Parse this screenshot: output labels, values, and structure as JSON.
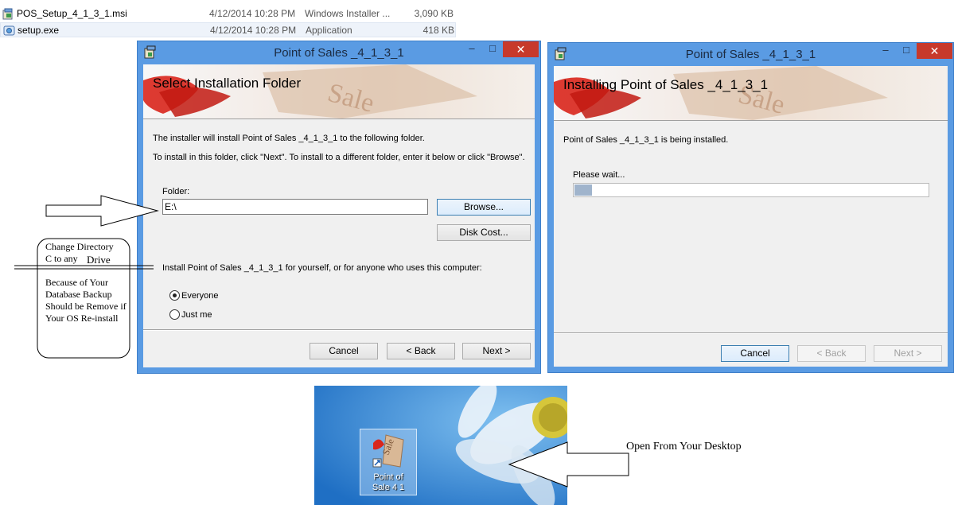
{
  "files": [
    {
      "name": "POS_Setup_4_1_3_1.msi",
      "date": "4/12/2014 10:28 PM",
      "type": "Windows Installer ...",
      "size": "3,090 KB",
      "icon": "msi-package-icon"
    },
    {
      "name": "setup.exe",
      "date": "4/12/2014 10:28 PM",
      "type": "Application",
      "size": "418 KB",
      "icon": "setup-exe-icon"
    }
  ],
  "window1": {
    "title": "Point of Sales _4_1_3_1",
    "heading": "Select Installation Folder",
    "line1": "The installer will install Point of Sales _4_1_3_1 to the following folder.",
    "line2": "To install in this folder, click \"Next\". To install to a different folder, enter it below or click \"Browse\".",
    "folder_label": "Folder:",
    "folder_value": "E:\\",
    "browse": "Browse...",
    "disk_cost": "Disk Cost...",
    "install_for": "Install Point of Sales _4_1_3_1 for yourself, or for anyone who uses this computer:",
    "everyone": "Everyone",
    "just_me": "Just me",
    "cancel": "Cancel",
    "back": "< Back",
    "next": "Next >",
    "min": "–",
    "max": "□",
    "close": "✕"
  },
  "window2": {
    "title": "Point of Sales _4_1_3_1",
    "heading": "Installing Point of Sales _4_1_3_1",
    "status": "Point of Sales _4_1_3_1 is being installed.",
    "wait": "Please wait...",
    "progress": 0.05,
    "cancel": "Cancel",
    "back": "< Back",
    "next": "Next >",
    "min": "–",
    "max": "□",
    "close": "✕"
  },
  "annotation": {
    "change_dir_1": "Change Directory",
    "change_dir_2": "C to any",
    "change_dir_3": "Drive",
    "because_1": "Because  of  Your",
    "because_2": "Database Backup",
    "because_3": "Should be Remove if",
    "because_4": "Your OS Re-install",
    "desktop_note": "Open From Your Desktop"
  },
  "desktop": {
    "icon_label_1": "Point of",
    "icon_label_2": "Sale 4 1"
  },
  "colors": {
    "titlebar": "#5a9be3",
    "close_button": "#c7392b",
    "desktop_bg": "#2f84d6"
  }
}
